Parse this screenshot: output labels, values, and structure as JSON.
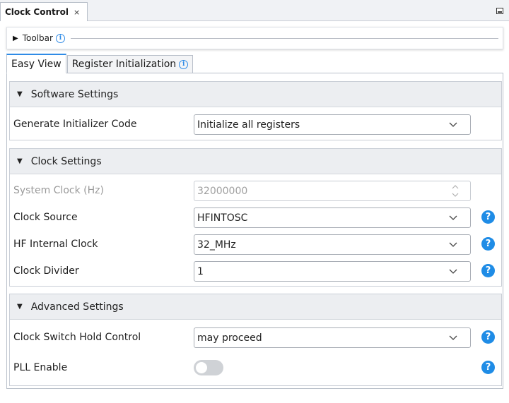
{
  "view_tab": {
    "title": "Clock Control",
    "close": "×"
  },
  "toolbar": {
    "label": "Toolbar",
    "info": "i"
  },
  "tabs": [
    {
      "label": "Easy View",
      "active": true
    },
    {
      "label": "Register Initialization",
      "active": false,
      "info": "i"
    }
  ],
  "software_settings": {
    "title": "Software Settings",
    "generate_initializer": {
      "label": "Generate Initializer Code",
      "value": "Initialize all registers"
    }
  },
  "clock_settings": {
    "title": "Clock Settings",
    "system_clock": {
      "label": "System Clock (Hz)",
      "value": "32000000",
      "disabled": true
    },
    "clock_source": {
      "label": "Clock Source",
      "value": "HFINTOSC"
    },
    "hf_internal_clock": {
      "label": "HF Internal Clock",
      "value": "32_MHz"
    },
    "clock_divider": {
      "label": "Clock Divider",
      "value": "1"
    }
  },
  "advanced_settings": {
    "title": "Advanced Settings",
    "clock_switch_hold": {
      "label": "Clock Switch Hold Control",
      "value": "may proceed"
    },
    "pll_enable": {
      "label": "PLL Enable",
      "value": false
    }
  },
  "help_glyph": "?",
  "colors": {
    "accent": "#1f8ce6",
    "section_header_bg": "#eceef1",
    "toggle_off": "#cfd2d6"
  }
}
